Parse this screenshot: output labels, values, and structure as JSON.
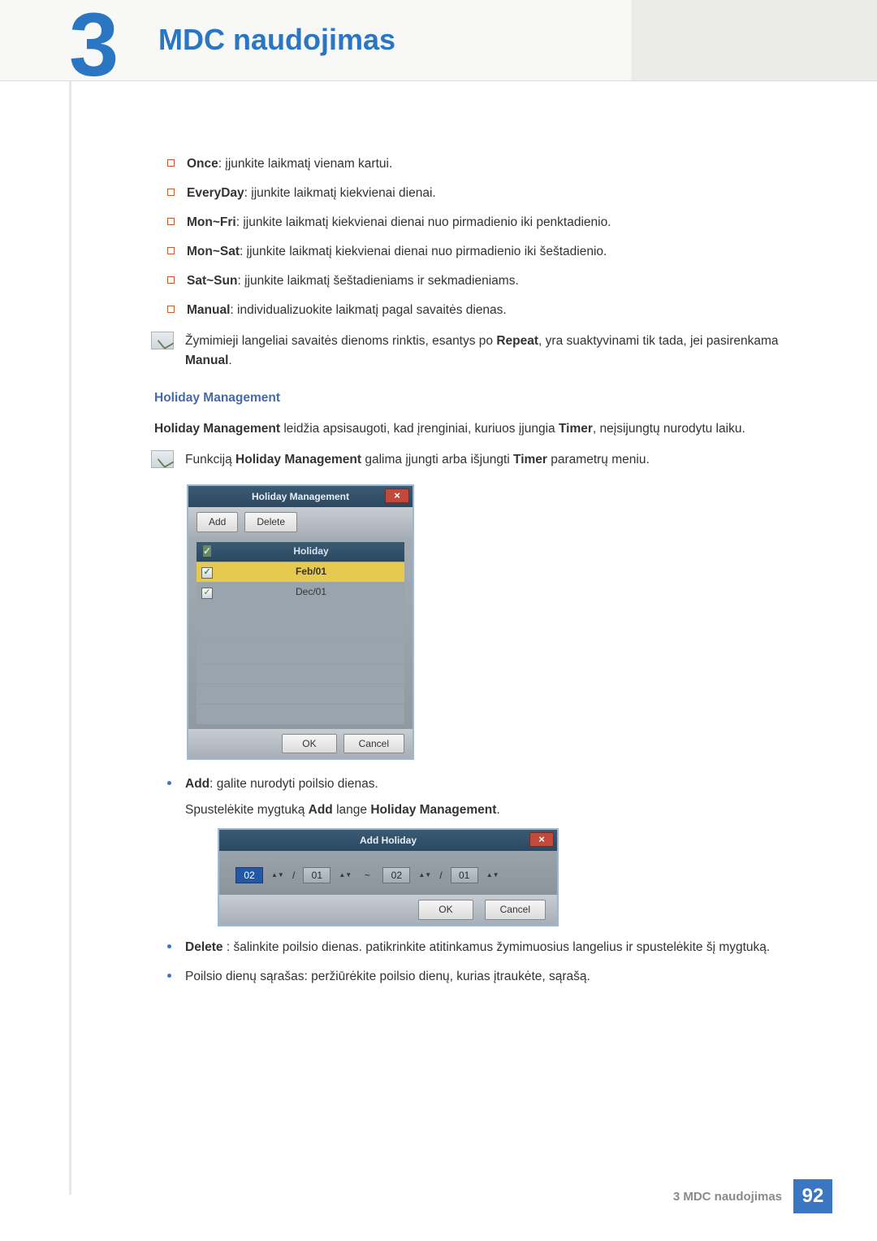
{
  "chapter": {
    "number": "3",
    "title": "MDC naudojimas"
  },
  "repeat_options": [
    {
      "term": "Once",
      "desc": ": įjunkite laikmatį vienam kartui."
    },
    {
      "term": "EveryDay",
      "desc": ": įjunkite laikmatį kiekvienai dienai."
    },
    {
      "term": "Mon~Fri",
      "desc": ": įjunkite laikmatį kiekvienai dienai nuo pirmadienio iki penktadienio."
    },
    {
      "term": "Mon~Sat",
      "desc": ": įjunkite laikmatį kiekvienai dienai nuo pirmadienio iki šeštadienio."
    },
    {
      "term": "Sat~Sun",
      "desc": ": įjunkite laikmatį šeštadieniams ir sekmadieniams."
    },
    {
      "term": "Manual",
      "desc": ": individualizuokite laikmatį pagal savaitės dienas."
    }
  ],
  "note_repeat_pre": "Žymimieji langeliai savaitės dienoms rinktis, esantys po ",
  "note_repeat_bold1": "Repeat",
  "note_repeat_mid": ", yra suaktyvinami tik tada, jei pasirenkama ",
  "note_repeat_bold2": "Manual",
  "note_repeat_post": ".",
  "hm_heading": "Holiday Management",
  "hm_para_pre": "Holiday Management",
  "hm_para_mid": " leidžia apsisaugoti, kad įrenginiai, kuriuos įjungia ",
  "hm_para_bold": "Timer",
  "hm_para_post": ", neįsijungtų nurodytu laiku.",
  "hm_note_pre": "Funkciją ",
  "hm_note_b1": "Holiday Management",
  "hm_note_mid": " galima įjungti arba išjungti ",
  "hm_note_b2": "Timer",
  "hm_note_post": " parametrų meniu.",
  "hm_dialog": {
    "title": "Holiday Management",
    "add": "Add",
    "delete": "Delete",
    "col_holiday": "Holiday",
    "rows": [
      "Feb/01",
      "Dec/01"
    ],
    "ok": "OK",
    "cancel": "Cancel",
    "close": "×"
  },
  "add_item_pre": "Add",
  "add_item_desc": ": galite nurodyti poilsio dienas.",
  "add_item_sub_pre": "Spustelėkite mygtuką ",
  "add_item_sub_b1": "Add",
  "add_item_sub_mid": " lange ",
  "add_item_sub_b2": "Holiday Management",
  "add_item_sub_post": ".",
  "ah_dialog": {
    "title": "Add Holiday",
    "from_month": "02",
    "from_day": "01",
    "to_month": "02",
    "to_day": "01",
    "sep": "/",
    "range": "~",
    "ok": "OK",
    "cancel": "Cancel",
    "close": "×"
  },
  "delete_item_pre": "Delete",
  "delete_item_desc": " : šalinkite poilsio dienas. patikrinkite atitinkamus žymimuosius langelius ir spustelėkite šį mygtuką.",
  "list_item3": "Poilsio dienų sąrašas: peržiūrėkite poilsio dienų, kurias įtraukėte, sąrašą.",
  "footer": {
    "text": "3 MDC naudojimas",
    "page": "92"
  }
}
